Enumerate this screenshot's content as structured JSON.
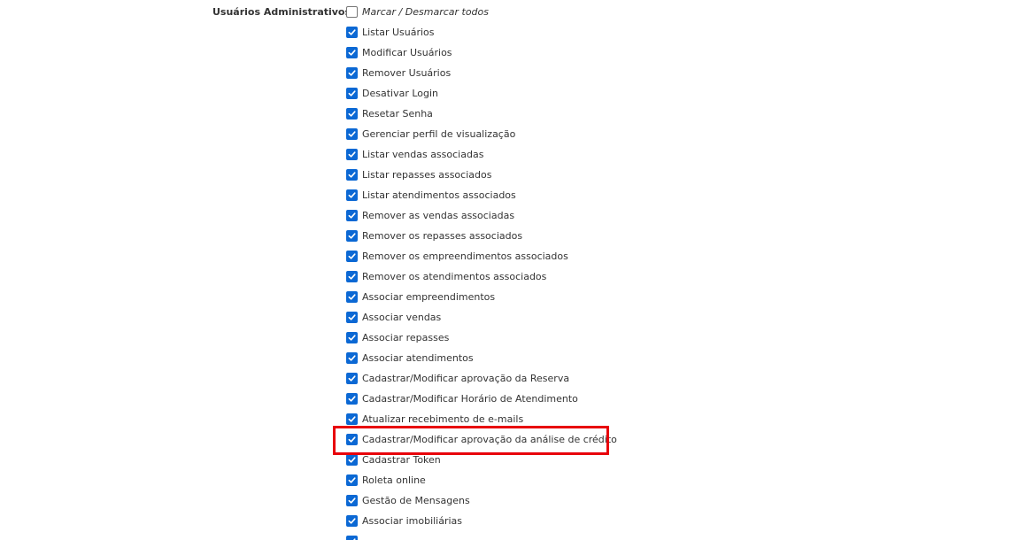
{
  "section": {
    "label": "Usuários Administrativos",
    "toggle_all": {
      "label": "Marcar / Desmarcar todos",
      "checked": false
    }
  },
  "permissions": [
    {
      "label": "Listar Usuários",
      "checked": true
    },
    {
      "label": "Modificar Usuários",
      "checked": true
    },
    {
      "label": "Remover Usuários",
      "checked": true
    },
    {
      "label": "Desativar Login",
      "checked": true
    },
    {
      "label": "Resetar Senha",
      "checked": true
    },
    {
      "label": "Gerenciar perfil de visualização",
      "checked": true
    },
    {
      "label": "Listar vendas associadas",
      "checked": true
    },
    {
      "label": "Listar repasses associados",
      "checked": true
    },
    {
      "label": "Listar atendimentos associados",
      "checked": true
    },
    {
      "label": "Remover as vendas associadas",
      "checked": true
    },
    {
      "label": "Remover os repasses associados",
      "checked": true
    },
    {
      "label": "Remover os empreendimentos associados",
      "checked": true
    },
    {
      "label": "Remover os atendimentos associados",
      "checked": true
    },
    {
      "label": "Associar empreendimentos",
      "checked": true
    },
    {
      "label": "Associar vendas",
      "checked": true
    },
    {
      "label": "Associar repasses",
      "checked": true
    },
    {
      "label": "Associar atendimentos",
      "checked": true
    },
    {
      "label": "Cadastrar/Modificar aprovação da Reserva",
      "checked": true
    },
    {
      "label": "Cadastrar/Modificar Horário de Atendimento",
      "checked": true
    },
    {
      "label": "Atualizar recebimento de e-mails",
      "checked": true
    },
    {
      "label": "Cadastrar/Modificar aprovação da análise de crédito",
      "checked": true,
      "highlighted": true
    },
    {
      "label": "Cadastrar Token",
      "checked": true
    },
    {
      "label": "Roleta online",
      "checked": true
    },
    {
      "label": "Gestão de Mensagens",
      "checked": true
    },
    {
      "label": "Associar imobiliárias",
      "checked": true
    },
    {
      "label": "",
      "checked": true
    }
  ],
  "colors": {
    "checkbox_checked": "#0b68d4",
    "highlight_border": "#e8000b",
    "text": "#333333"
  }
}
